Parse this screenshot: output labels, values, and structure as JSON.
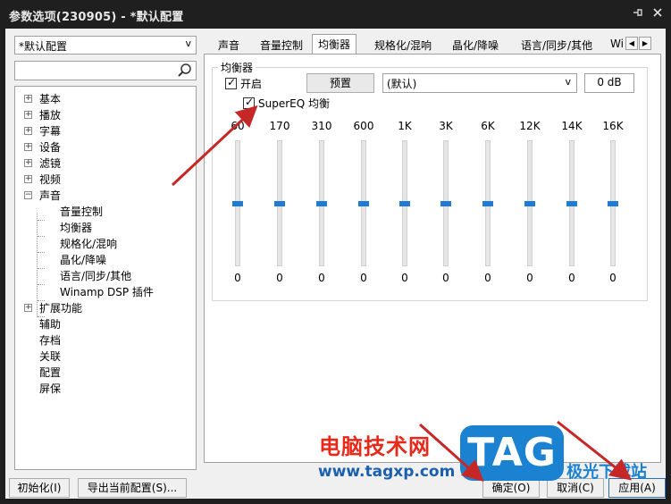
{
  "window": {
    "title": "参数选项(230905) - *默认配置",
    "pin_icon": "pin-icon",
    "close_icon": "close-icon"
  },
  "left": {
    "preset": {
      "value": "*默认配置"
    },
    "search": {
      "placeholder": "",
      "icon": "search-icon"
    },
    "tree": {
      "items": [
        {
          "label": "基本",
          "expander": "+"
        },
        {
          "label": "播放",
          "expander": "+"
        },
        {
          "label": "字幕",
          "expander": "+"
        },
        {
          "label": "设备",
          "expander": "+"
        },
        {
          "label": "滤镜",
          "expander": "+"
        },
        {
          "label": "视频",
          "expander": "+"
        },
        {
          "label": "声音",
          "expander": "−"
        },
        {
          "label": "音量控制"
        },
        {
          "label": "均衡器"
        },
        {
          "label": "规格化/混响"
        },
        {
          "label": "晶化/降噪"
        },
        {
          "label": "语言/同步/其他"
        },
        {
          "label": "Winamp DSP 插件"
        },
        {
          "label": "扩展功能",
          "expander": "+"
        },
        {
          "label": "辅助"
        },
        {
          "label": "存档"
        },
        {
          "label": "关联"
        },
        {
          "label": "配置"
        },
        {
          "label": "屏保"
        }
      ]
    }
  },
  "tabs": [
    {
      "label": "声音"
    },
    {
      "label": "音量控制"
    },
    {
      "label": "均衡器"
    },
    {
      "label": "规格化/混响"
    },
    {
      "label": "晶化/降噪"
    },
    {
      "label": "语言/同步/其他"
    },
    {
      "label": "Wi"
    }
  ],
  "tab_scroll": {
    "left": "◀",
    "right": "▶"
  },
  "equalizer": {
    "group_title": "均衡器",
    "enable_label": "开启",
    "enable_checked": true,
    "preset_button": "预置",
    "preset_select": "(默认)",
    "gain_value": "0 dB",
    "supereq_label": "SuperEQ 均衡",
    "supereq_checked": true,
    "check_mark": "✓",
    "bands": [
      {
        "freq": "60",
        "value": "0"
      },
      {
        "freq": "170",
        "value": "0"
      },
      {
        "freq": "310",
        "value": "0"
      },
      {
        "freq": "600",
        "value": "0"
      },
      {
        "freq": "1K",
        "value": "0"
      },
      {
        "freq": "3K",
        "value": "0"
      },
      {
        "freq": "6K",
        "value": "0"
      },
      {
        "freq": "12K",
        "value": "0"
      },
      {
        "freq": "14K",
        "value": "0"
      },
      {
        "freq": "16K",
        "value": "0"
      }
    ]
  },
  "footer": {
    "init_button": "初始化(I)",
    "export_button": "导出当前配置(S)...",
    "ok_button": "确定(O)",
    "cancel_button": "取消(C)",
    "apply_button": "应用(A)"
  },
  "watermark": {
    "site_name": "电脑技术网",
    "site_url": "www.tagxp.com",
    "logo_text": "TAG",
    "logo_sub": "极光下载站"
  },
  "colors": {
    "slider_thumb": "#1f7bd4",
    "annotation_arrow": "#c62828",
    "watermark_red": "#e8291a",
    "watermark_blue": "#1b82d1"
  }
}
